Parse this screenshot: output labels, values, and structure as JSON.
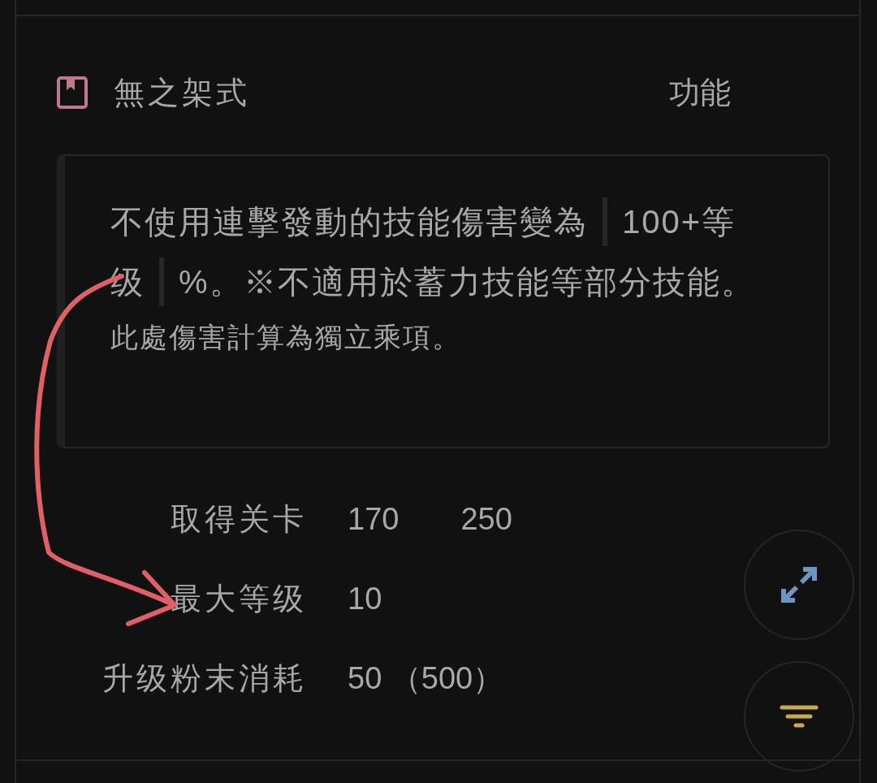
{
  "header": {
    "title": "無之架式",
    "category": "功能"
  },
  "description": {
    "segments": [
      {
        "kind": "text",
        "text": "不使用連擊發動的技能傷害變為"
      },
      {
        "kind": "code",
        "text": "100+等级"
      },
      {
        "kind": "text",
        "text": "%。※不適用於蓄力技能等部分技能。"
      }
    ],
    "note": "此處傷害計算為獨立乘項。"
  },
  "stats": [
    {
      "label": "取得关卡",
      "values": [
        "170",
        "250"
      ]
    },
    {
      "label": "最大等级",
      "values": [
        "10"
      ]
    },
    {
      "label": "升级粉末消耗",
      "values": [
        "50 （500）"
      ]
    }
  ]
}
